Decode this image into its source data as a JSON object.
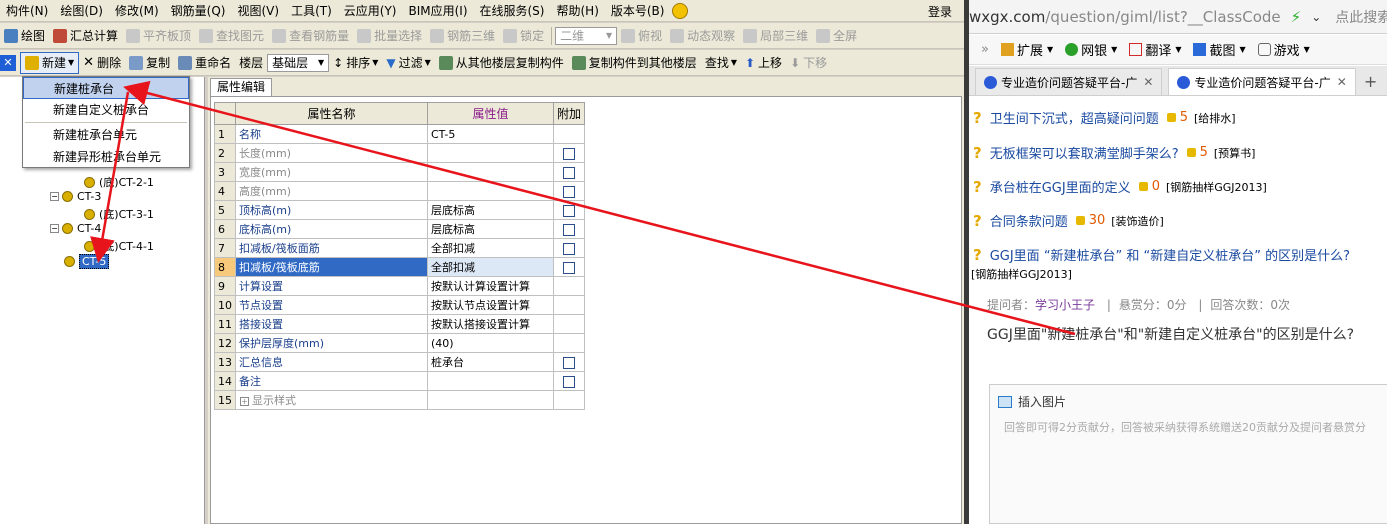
{
  "menu": {
    "items": [
      "构件(N)",
      "绘图(D)",
      "修改(M)",
      "钢筋量(Q)",
      "视图(V)",
      "工具(T)",
      "云应用(Y)",
      "BIM应用(I)",
      "在线服务(S)",
      "帮助(H)",
      "版本号(B)"
    ],
    "login": "登录"
  },
  "toolbar1": {
    "draw": "绘图",
    "calc": "汇总计算",
    "align": "平齐板顶",
    "find": "查找图元",
    "view_rebar": "查看钢筋量",
    "batch": "批量选择",
    "rebar3d": "钢筋三维",
    "lock": "锁定",
    "view2d": "二维",
    "topview": "俯视",
    "dynamic": "动态观察",
    "local3d": "局部三维",
    "fullscreen": "全屏"
  },
  "toolbar2": {
    "new": "新建",
    "delete": "删除",
    "copy": "复制",
    "rename": "重命名",
    "floor_label": "楼层",
    "floor_value": "基础层",
    "sort": "排序",
    "filter": "过滤",
    "copy_from": "从其他楼层复制构件",
    "copy_to": "复制构件到其他楼层",
    "search": "查找",
    "up": "上移",
    "down": "下移"
  },
  "dropdown": {
    "items": [
      "新建桩承台",
      "新建自定义桩承台",
      "新建桩承台单元",
      "新建异形桩承台单元"
    ],
    "highlighted": 0
  },
  "tree": {
    "nodes": [
      "(底)CT-2-1",
      "CT-3",
      "(底)CT-3-1",
      "CT-4",
      "(底)CT-4-1",
      "CT-5"
    ],
    "selected": "CT-5"
  },
  "props": {
    "tab": "属性编辑",
    "headers": {
      "name": "属性名称",
      "value": "属性值",
      "extra": "附加"
    },
    "rows": [
      {
        "no": "1",
        "name": "名称",
        "value": "CT-5",
        "cb": false,
        "dim": false
      },
      {
        "no": "2",
        "name": "长度(mm)",
        "value": "",
        "cb": true,
        "dim": true
      },
      {
        "no": "3",
        "name": "宽度(mm)",
        "value": "",
        "cb": true,
        "dim": true
      },
      {
        "no": "4",
        "name": "高度(mm)",
        "value": "",
        "cb": true,
        "dim": true
      },
      {
        "no": "5",
        "name": "顶标高(m)",
        "value": "层底标高",
        "cb": true,
        "dim": false
      },
      {
        "no": "6",
        "name": "底标高(m)",
        "value": "层底标高",
        "cb": true,
        "dim": false
      },
      {
        "no": "7",
        "name": "扣减板/筏板面筋",
        "value": "全部扣减",
        "cb": true,
        "dim": false
      },
      {
        "no": "8",
        "name": "扣减板/筏板底筋",
        "value": "全部扣减",
        "cb": true,
        "dim": false,
        "selected": true
      },
      {
        "no": "9",
        "name": "计算设置",
        "value": "按默认计算设置计算",
        "cb": false,
        "dim": false
      },
      {
        "no": "10",
        "name": "节点设置",
        "value": "按默认节点设置计算",
        "cb": false,
        "dim": false
      },
      {
        "no": "11",
        "name": "搭接设置",
        "value": "按默认搭接设置计算",
        "cb": false,
        "dim": false
      },
      {
        "no": "12",
        "name": "保护层厚度(mm)",
        "value": "(40)",
        "cb": false,
        "dim": false
      },
      {
        "no": "13",
        "name": "汇总信息",
        "value": "桩承台",
        "cb": true,
        "dim": false
      },
      {
        "no": "14",
        "name": "备注",
        "value": "",
        "cb": true,
        "dim": false
      },
      {
        "no": "15",
        "name": "显示样式",
        "value": "",
        "cb": false,
        "dim": true,
        "expand": true
      }
    ]
  },
  "browser": {
    "url_main": "wxgx.com",
    "url_path": "/question/giml/list?__ClassCode",
    "search_hint": "点此搜索",
    "bookmarks": [
      "扩展",
      "网银",
      "翻译",
      "截图",
      "游戏"
    ],
    "tabs": [
      "专业造价问题答疑平台-广",
      "专业造价问题答疑平台-广"
    ],
    "questions": [
      {
        "title": "卫生间下沉式，超高疑问问题",
        "coins": "5",
        "cat": "[给排水]"
      },
      {
        "title": "无板框架可以套取满堂脚手架么?",
        "coins": "5",
        "cat": "[预算书]"
      },
      {
        "title": "承台桩在GGJ里面的定义",
        "coins": "0",
        "cat": "[钢筋抽样GGJ2013]"
      },
      {
        "title": "合同条款问题",
        "coins": "30",
        "cat": "[装饰造价]"
      },
      {
        "title": "GGJ里面 “新建桩承台” 和 “新建自定义桩承台” 的区别是什么?",
        "coins": "",
        "cat": "[钢筋抽样GGJ2013]"
      }
    ],
    "meta": {
      "asker_label": "提问者：",
      "asker": "学习小王子",
      "reward": "悬赏分：0分",
      "answers": "回答次数：0次"
    },
    "question_body": "GGJ里面\"新建桩承台\"和\"新建自定义桩承台\"的区别是什么?",
    "insert_image": "插入图片",
    "editor_placeholder": "回答即可得2分贡献分，回答被采纳获得系统赠送20贡献分及提问者悬赏分"
  },
  "colors": {
    "arrow": "#e8141b",
    "selection": "#316ac5",
    "value_header": "#f7c97a"
  }
}
